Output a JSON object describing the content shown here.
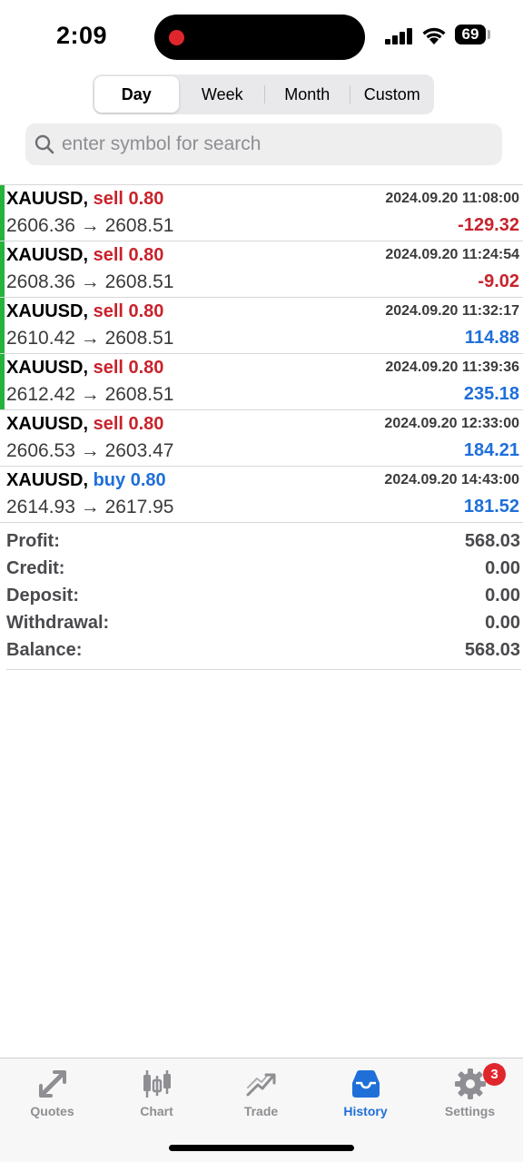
{
  "status_bar": {
    "time": "2:09",
    "battery": "69"
  },
  "period_tabs": [
    "Day",
    "Week",
    "Month",
    "Custom"
  ],
  "active_period": "Day",
  "search": {
    "placeholder": "enter symbol for search",
    "value": ""
  },
  "deals": [
    {
      "symbol": "XAUUSD,",
      "type": "sell 0.80",
      "side": "sell",
      "prices": "2606.36 → 2608.51",
      "time": "2024.09.20 11:08:00",
      "profit": "-129.32",
      "marker": true
    },
    {
      "symbol": "XAUUSD,",
      "type": "sell 0.80",
      "side": "sell",
      "prices": "2608.36 → 2608.51",
      "time": "2024.09.20 11:24:54",
      "profit": "-9.02",
      "marker": true
    },
    {
      "symbol": "XAUUSD,",
      "type": "sell 0.80",
      "side": "sell",
      "prices": "2610.42 → 2608.51",
      "time": "2024.09.20 11:32:17",
      "profit": "114.88",
      "marker": true
    },
    {
      "symbol": "XAUUSD,",
      "type": "sell 0.80",
      "side": "sell",
      "prices": "2612.42 → 2608.51",
      "time": "2024.09.20 11:39:36",
      "profit": "235.18",
      "marker": true
    },
    {
      "symbol": "XAUUSD,",
      "type": "sell 0.80",
      "side": "sell",
      "prices": "2606.53 → 2603.47",
      "time": "2024.09.20 12:33:00",
      "profit": "184.21",
      "marker": false
    },
    {
      "symbol": "XAUUSD,",
      "type": "buy 0.80",
      "side": "buy",
      "prices": "2614.93 → 2617.95",
      "time": "2024.09.20 14:43:00",
      "profit": "181.52",
      "marker": false
    }
  ],
  "summary": [
    {
      "label": "Profit:",
      "value": "568.03"
    },
    {
      "label": "Credit:",
      "value": "0.00"
    },
    {
      "label": "Deposit:",
      "value": "0.00"
    },
    {
      "label": "Withdrawal:",
      "value": "0.00"
    },
    {
      "label": "Balance:",
      "value": "568.03"
    }
  ],
  "tabbar": {
    "items": [
      {
        "label": "Quotes",
        "icon": "quotes-icon"
      },
      {
        "label": "Chart",
        "icon": "chart-icon"
      },
      {
        "label": "Trade",
        "icon": "trade-icon"
      },
      {
        "label": "History",
        "icon": "history-icon"
      },
      {
        "label": "Settings",
        "icon": "gear-icon"
      }
    ],
    "active": "History",
    "settings_badge": "3"
  },
  "colors": {
    "sell": "#c8232c",
    "buy": "#1f6fd9",
    "marker": "#25b33b",
    "active_tab": "#1f6fd9"
  }
}
